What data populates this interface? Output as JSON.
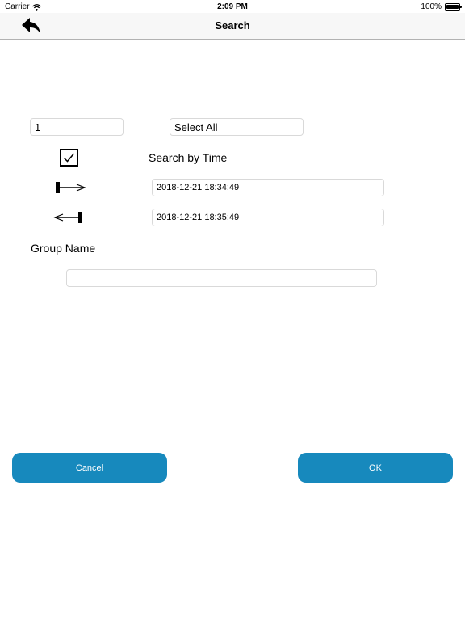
{
  "status_bar": {
    "carrier": "Carrier",
    "time": "2:09 PM",
    "battery": "100%",
    "wifi_icon": "wifi-icon",
    "battery_icon": "battery-icon"
  },
  "nav": {
    "title": "Search",
    "back_icon": "back-arrow-icon"
  },
  "form": {
    "number_value": "1",
    "select_all_label": "Select All",
    "search_by_time_checked": true,
    "search_by_time_label": "Search by Time",
    "start_time": "2018-12-21 18:34:49",
    "end_time": "2018-12-21 18:35:49",
    "group_name_label": "Group Name",
    "group_name_value": ""
  },
  "buttons": {
    "cancel_label": "Cancel",
    "ok_label": "OK"
  },
  "colors": {
    "button_bg": "#1789bd",
    "button_text": "#ffffff",
    "nav_bg": "#f7f7f7",
    "field_border": "#d9d9d9"
  }
}
